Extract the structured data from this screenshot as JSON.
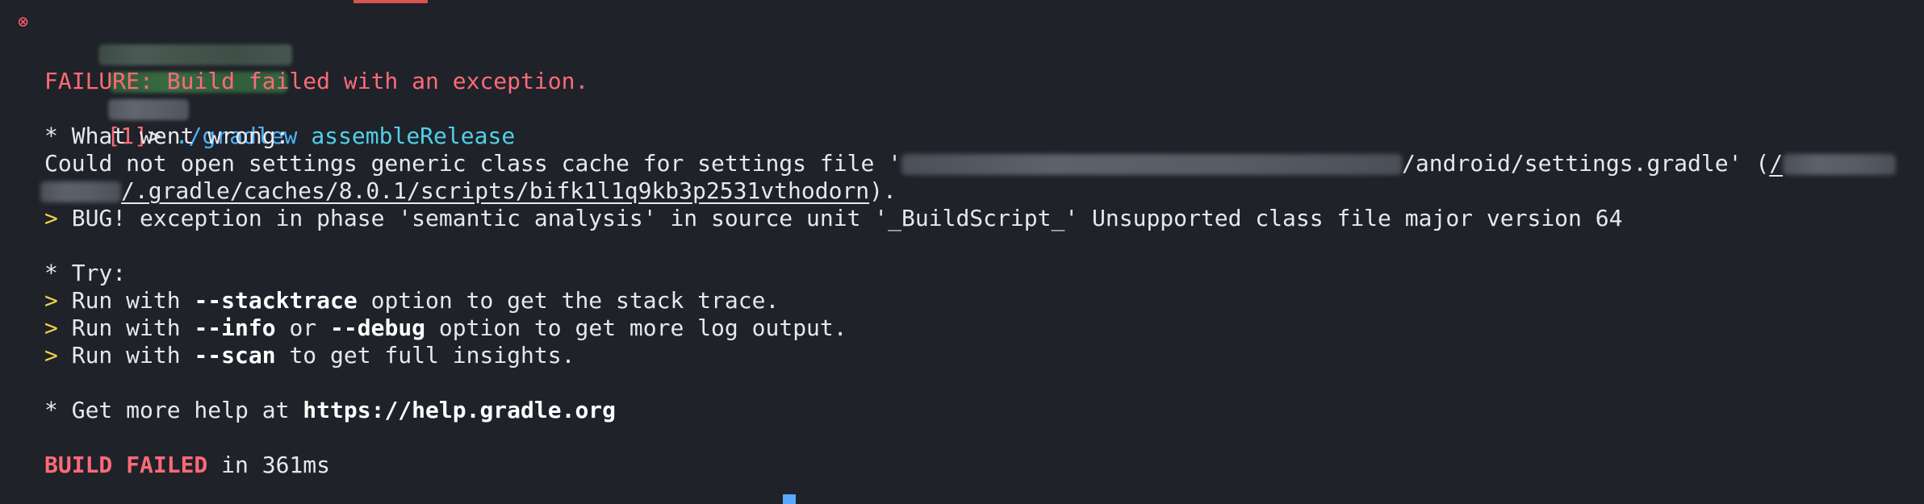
{
  "prompt": {
    "job_marker": "[1]",
    "gt": ">",
    "cmd_name": "./gradlew",
    "cmd_args": "assembleRelease",
    "redacted_segments": [
      "user-host",
      "path",
      "branch"
    ],
    "error_icon": "circled-x-icon"
  },
  "output": {
    "failure": "FAILURE: Build failed with an exception.",
    "what_wrong_header": "* What went wrong:",
    "could_not_prefix": "Could not open settings generic class cache for settings file '",
    "redacted_path_1": "path",
    "path_suffix_1": "/android/settings.gradle' (",
    "path_link_start": "/",
    "redacted_path_2": "path",
    "path_link_rest": "/.gradle/caches/8.0.1/scripts/bifk1l1q9kb3p2531vthodorn",
    "path_end": ").",
    "bug_arrow": ">",
    "bug_line": " BUG! exception in phase 'semantic analysis' in source unit '_BuildScript_' Unsupported class file major version 64",
    "try_header": "* Try:",
    "try_items": [
      {
        "arrow": ">",
        "pre": " Run with ",
        "flag": "--stacktrace",
        "post": " option to get the stack trace."
      },
      {
        "arrow": ">",
        "pre": " Run with ",
        "flag": "--info",
        "mid": " or ",
        "flag2": "--debug",
        "post": " option to get more log output."
      },
      {
        "arrow": ">",
        "pre": " Run with ",
        "flag": "--scan",
        "post": " to get full insights."
      }
    ],
    "help_prefix": "* Get more help at ",
    "help_url": "https://help.gradle.org",
    "build_failed": "BUILD FAILED",
    "build_time": " in 361ms"
  },
  "colors": {
    "background": "#1f2229",
    "error": "#ff6a78",
    "arrow": "#f2d34a",
    "command": "#4cb2ff",
    "args": "#4fd1e8"
  }
}
